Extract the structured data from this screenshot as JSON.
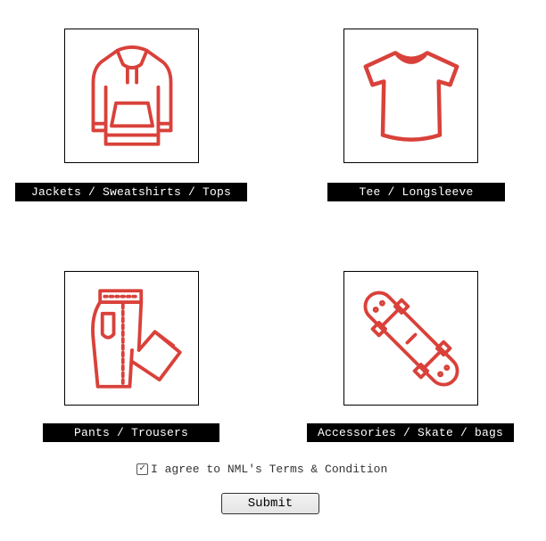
{
  "categories": [
    {
      "label": "Jackets / Sweatshirts / Tops",
      "icon": "hoodie-icon"
    },
    {
      "label": "Tee / Longsleeve",
      "icon": "tshirt-icon"
    },
    {
      "label": "Pants / Trousers",
      "icon": "pants-icon"
    },
    {
      "label": "Accessories / Skate / bags",
      "icon": "skateboard-icon"
    }
  ],
  "terms": {
    "checked": true,
    "check_glyph": "✓",
    "label": "I agree to NML's Terms & Condition"
  },
  "submit": {
    "label": "Submit"
  },
  "colors": {
    "icon_stroke": "#d9413a",
    "label_bg": "#000000",
    "label_text": "#ffffff"
  }
}
